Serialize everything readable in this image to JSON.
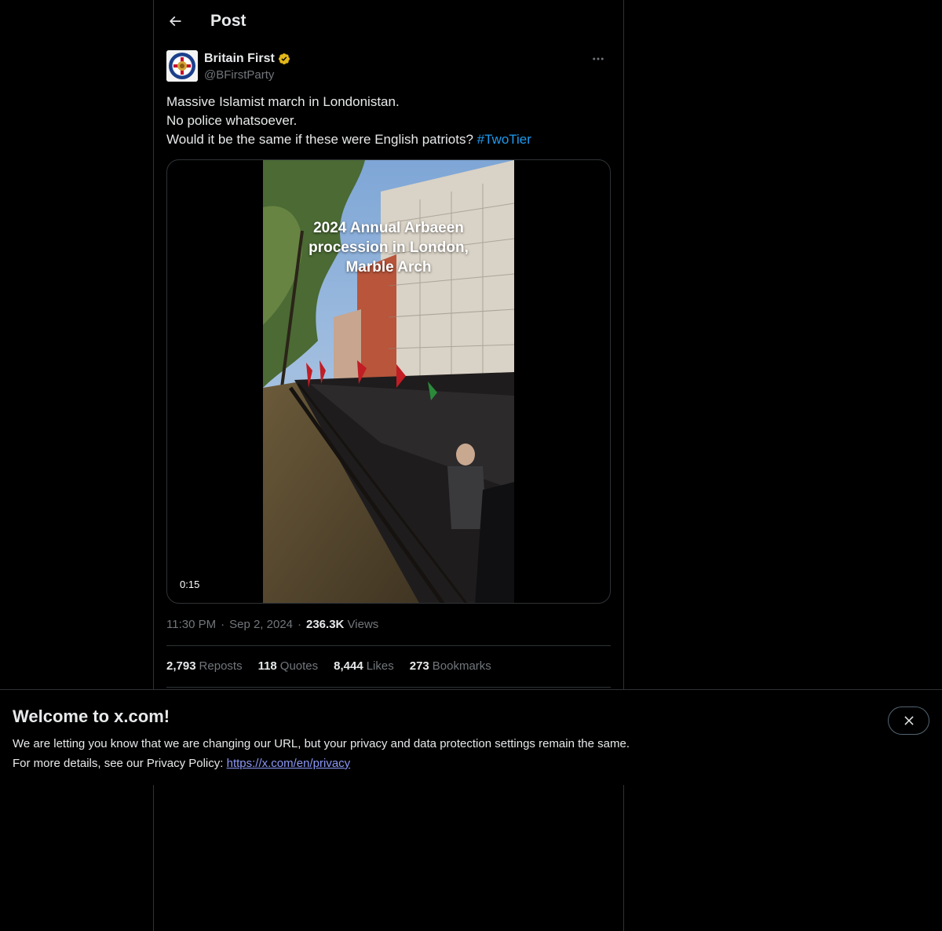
{
  "header": {
    "title": "Post",
    "back_icon": "arrow-left-icon"
  },
  "post": {
    "author": {
      "display_name": "Britain First",
      "handle": "@BFirstParty",
      "verified": true,
      "verified_color": "#e2b719"
    },
    "text": {
      "line1": "Massive Islamist march in Londonistan.",
      "line2": "No police whatsoever.",
      "line3": "Would it be the same if these were English patriots?",
      "hashtag": "#TwoTier"
    },
    "media": {
      "caption": "2024 Annual Arbaeen procession in London, Marble Arch",
      "duration": "0:15"
    },
    "meta": {
      "time": "11:30 PM",
      "date": "Sep 2, 2024",
      "views_count": "236.3K",
      "views_label": "Views"
    },
    "stats": {
      "reposts_count": "2,793",
      "reposts_label": "Reposts",
      "quotes_count": "118",
      "quotes_label": "Quotes",
      "likes_count": "8,444",
      "likes_label": "Likes",
      "bookmarks_count": "273",
      "bookmarks_label": "Bookmarks"
    }
  },
  "banner": {
    "title": "Welcome to x.com!",
    "line1": "We are letting you know that we are changing our URL, but your privacy and data protection settings remain the same.",
    "line2_prefix": "For more details, see our Privacy Policy:",
    "link": "https://x.com/en/privacy",
    "close_icon": "close-icon"
  },
  "colors": {
    "background": "#000000",
    "text": "#e7e9ea",
    "muted": "#71767b",
    "accent": "#1d9bf0",
    "border": "#2f3336",
    "link": "#8b98f7"
  }
}
